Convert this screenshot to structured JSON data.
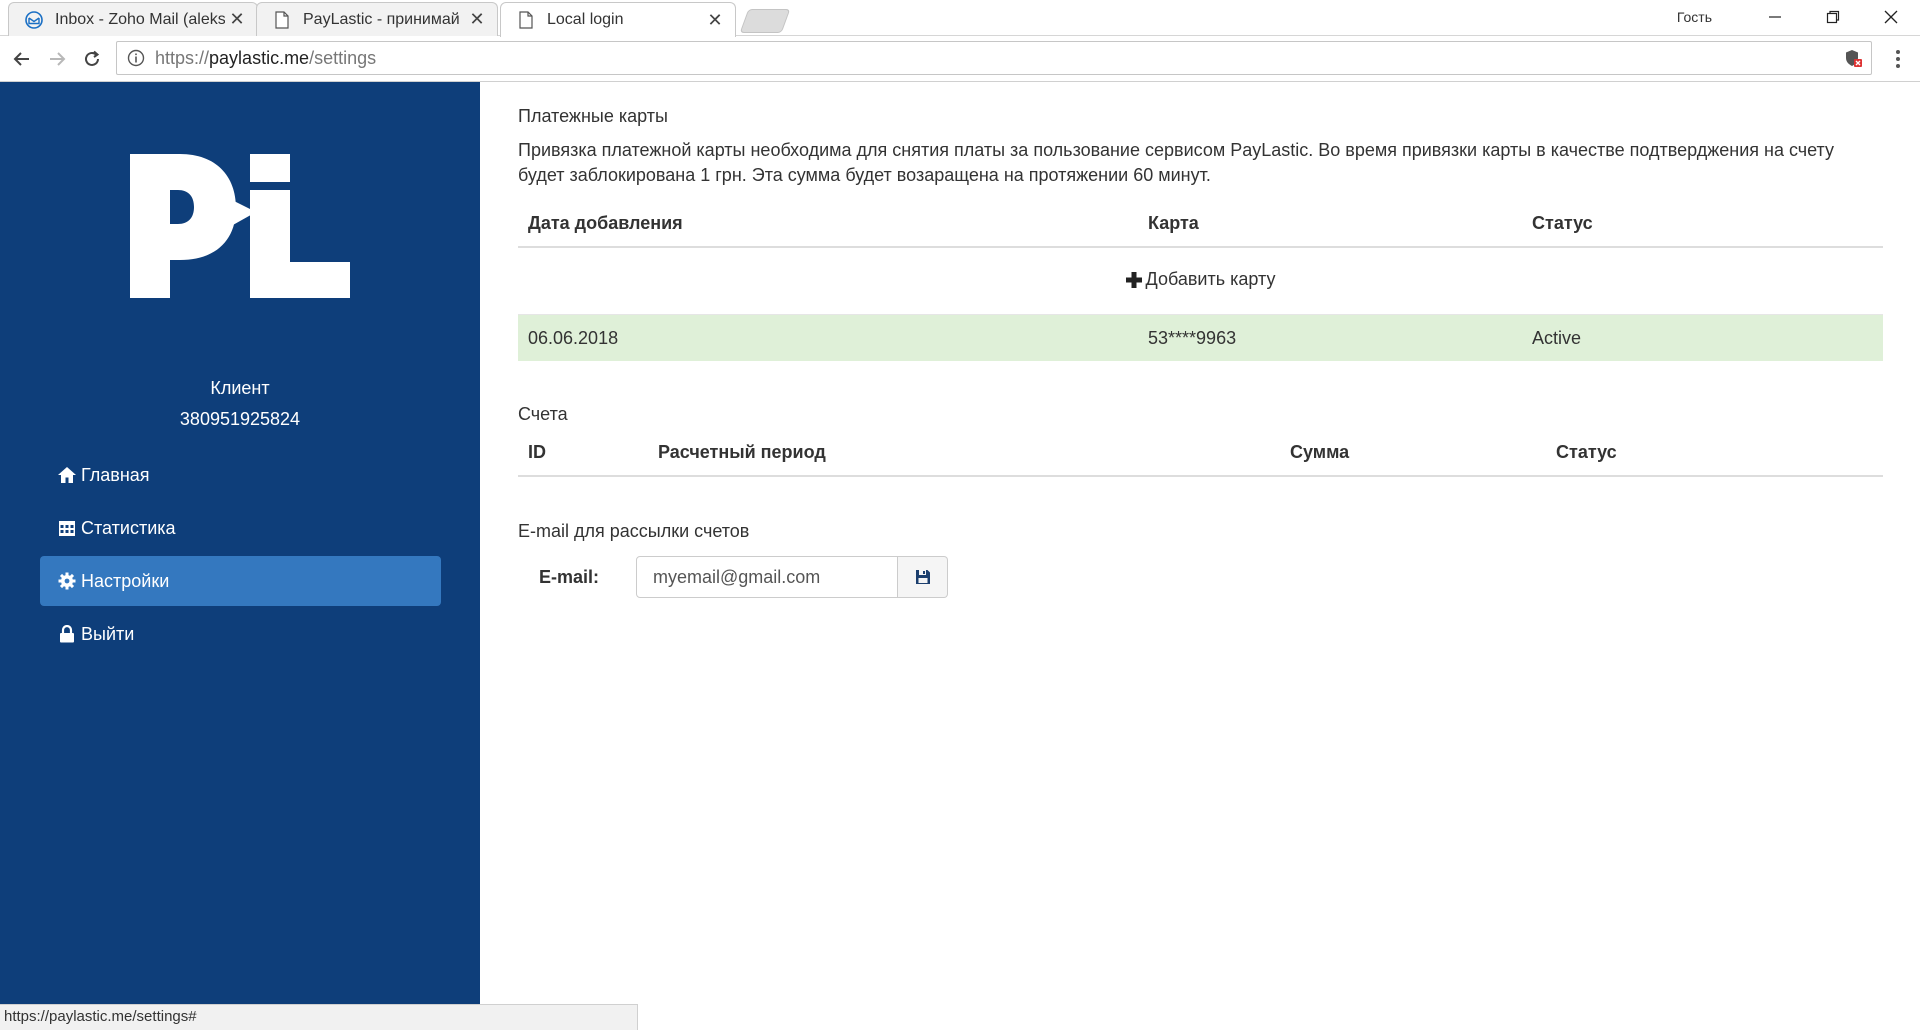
{
  "browser": {
    "tabs": [
      {
        "title": "Inbox - Zoho Mail (aleksa",
        "icon": "mail-icon"
      },
      {
        "title": "PayLastic - принимай ка",
        "icon": "page-icon"
      },
      {
        "title": "Local login",
        "icon": "page-icon"
      }
    ],
    "guest_label": "Гость",
    "url": {
      "scheme": "https://",
      "host": "paylastic.me",
      "path": "/settings"
    },
    "status_url": "https://paylastic.me/settings#"
  },
  "sidebar": {
    "client_label": "Клиент",
    "client_phone": "380951925824",
    "nav": [
      {
        "label": "Главная",
        "icon": "home-icon"
      },
      {
        "label": "Статистика",
        "icon": "calendar-icon"
      },
      {
        "label": "Настройки",
        "icon": "gear-icon",
        "active": true
      },
      {
        "label": "Выйти",
        "icon": "lock-icon"
      }
    ]
  },
  "cards": {
    "title": "Платежные карты",
    "description": "Привязка платежной карты необходима для снятия платы за пользование сервисом PayLastic. Во время привязки карты в качестве подтверджения на счету будет заблокирована 1 грн. Эта сумма будет возаращена на протяжении 60 минут.",
    "columns": [
      "Дата добавления",
      "Карта",
      "Статус"
    ],
    "add_label": "Добавить карту",
    "rows": [
      {
        "date": "06.06.2018",
        "card": "53****9963",
        "status": "Active"
      }
    ]
  },
  "invoices": {
    "title": "Счета",
    "columns": [
      "ID",
      "Расчетный период",
      "Сумма",
      "Статус"
    ]
  },
  "email": {
    "title": "E-mail для рассылки счетов",
    "label": "E-mail:",
    "value": "myemail@gmail.com"
  },
  "colors": {
    "sidebar_bg": "#0e3e7a",
    "active_nav": "#3478bf",
    "success_row": "#dff0d8"
  }
}
